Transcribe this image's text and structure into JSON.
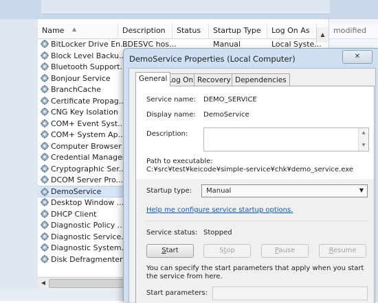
{
  "background": {
    "right_pane_header": "modified"
  },
  "list": {
    "columns": [
      "Name",
      "Description",
      "Status",
      "Startup Type",
      "Log On As"
    ],
    "rows": [
      {
        "name": "BitLocker Drive En...",
        "description": "BDESVC hos...",
        "status": "",
        "startup": "Manual",
        "logon": "Local Syste..."
      },
      {
        "name": "Block Level Backu...",
        "description": "",
        "status": "",
        "startup": "",
        "logon": ""
      },
      {
        "name": "Bluetooth Support...",
        "description": "",
        "status": "",
        "startup": "",
        "logon": ""
      },
      {
        "name": "Bonjour Service",
        "description": "",
        "status": "",
        "startup": "",
        "logon": ""
      },
      {
        "name": "BranchCache",
        "description": "",
        "status": "",
        "startup": "",
        "logon": ""
      },
      {
        "name": "Certificate Propag...",
        "description": "",
        "status": "",
        "startup": "",
        "logon": ""
      },
      {
        "name": "CNG Key Isolation",
        "description": "",
        "status": "",
        "startup": "",
        "logon": ""
      },
      {
        "name": "COM+ Event Syst...",
        "description": "",
        "status": "",
        "startup": "",
        "logon": ""
      },
      {
        "name": "COM+ System Ap...",
        "description": "",
        "status": "",
        "startup": "",
        "logon": ""
      },
      {
        "name": "Computer Browser",
        "description": "",
        "status": "",
        "startup": "",
        "logon": ""
      },
      {
        "name": "Credential Manager",
        "description": "",
        "status": "",
        "startup": "",
        "logon": ""
      },
      {
        "name": "Cryptographic Ser...",
        "description": "",
        "status": "",
        "startup": "",
        "logon": ""
      },
      {
        "name": "DCOM Server Pro...",
        "description": "",
        "status": "",
        "startup": "",
        "logon": ""
      },
      {
        "name": "DemoService",
        "description": "",
        "status": "",
        "startup": "",
        "logon": "",
        "selected": true
      },
      {
        "name": "Desktop Window ...",
        "description": "",
        "status": "",
        "startup": "",
        "logon": ""
      },
      {
        "name": "DHCP Client",
        "description": "",
        "status": "",
        "startup": "",
        "logon": ""
      },
      {
        "name": "Diagnostic Policy ...",
        "description": "",
        "status": "",
        "startup": "",
        "logon": ""
      },
      {
        "name": "Diagnostic Service...",
        "description": "",
        "status": "",
        "startup": "",
        "logon": ""
      },
      {
        "name": "Diagnostic System...",
        "description": "",
        "status": "",
        "startup": "",
        "logon": ""
      },
      {
        "name": "Disk Defragmenter",
        "description": "",
        "status": "",
        "startup": "",
        "logon": ""
      }
    ]
  },
  "dialog": {
    "title": "DemoService Properties (Local Computer)",
    "close_glyph": "✕",
    "tabs": [
      "General",
      "Log On",
      "Recovery",
      "Dependencies"
    ],
    "active_tab": "General",
    "service_name_label": "Service name:",
    "service_name": "DEMO_SERVICE",
    "display_name_label": "Display name:",
    "display_name": "DemoService",
    "description_label": "Description:",
    "path_label": "Path to executable:",
    "path": "C:¥src¥test¥keicode¥simple-service¥chk¥demo_service.exe",
    "startup_type_label": "Startup type:",
    "startup_type": "Manual",
    "help_link": "Help me configure service startup options.",
    "status_label": "Service status:",
    "status": "Stopped",
    "buttons": {
      "start": "Start",
      "stop": "Stop",
      "pause": "Pause",
      "resume": "Resume"
    },
    "params_note": "You can specify the start parameters that apply when you start the service from here.",
    "params_label": "Start parameters:"
  },
  "colors": {
    "accent": "#1a54b8",
    "selection": "#d7e6f7",
    "dialog_frame": "#cfe0f2"
  }
}
